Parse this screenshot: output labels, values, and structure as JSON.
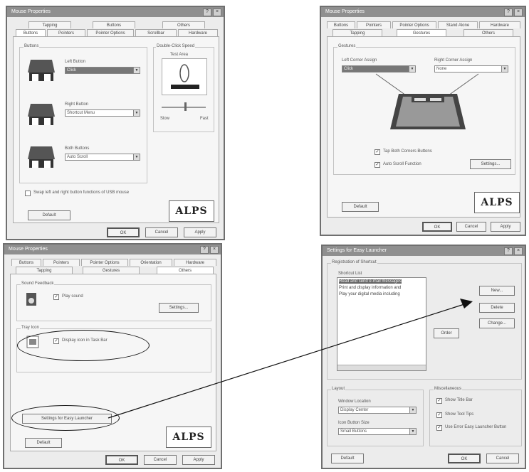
{
  "tl": {
    "title": "Mouse Properties",
    "tabs_row1": [
      "Tapping",
      "Buttons",
      "Others"
    ],
    "tabs_row2": [
      "Buttons",
      "Pointers",
      "Pointer Options",
      "Scrollbar",
      "Hardware"
    ],
    "buttons_group": "Buttons",
    "left_button_label": "Left Button",
    "left_button_value": "Click",
    "right_button_label": "Right Button",
    "right_button_value": "Shortcut Menu",
    "both_buttons_label": "Both Buttons",
    "both_buttons_value": "Auto Scroll",
    "dbl_click_group": "Double-Click Speed",
    "test_area": "Test Area",
    "slow": "Slow",
    "fast": "Fast",
    "swap_label": "Swap left and right button functions of USB mouse",
    "default_btn": "Default",
    "logo": "ALPS",
    "ok": "OK",
    "cancel": "Cancel",
    "apply": "Apply"
  },
  "tr": {
    "title": "Mouse Properties",
    "tabs_row1": [
      "Buttons",
      "Pointers",
      "Pointer Options",
      "Stand Alone",
      "Hardware"
    ],
    "tabs_row2": [
      "Tapping",
      "Gestures",
      "Others"
    ],
    "group": "Gestures",
    "left_corner_label": "Left Corner Assign",
    "left_corner_value": "Click",
    "right_corner_label": "Right Corner Assign",
    "right_corner_value": "None",
    "cb_tap_both": "Tap Both Corners Buttons",
    "cb_scroll": "Auto Scroll Function",
    "settings_btn": "Settings...",
    "default_btn": "Default",
    "logo": "ALPS",
    "ok": "OK",
    "cancel": "Cancel",
    "apply": "Apply"
  },
  "bl": {
    "title": "Mouse Properties",
    "tabs_row1": [
      "Buttons",
      "Pointers",
      "Pointer Options",
      "Orientation",
      "Hardware"
    ],
    "tabs_row2": [
      "Tapping",
      "Gestures",
      "Others"
    ],
    "sound_group": "Sound Feedback",
    "sound_cb": "Play sound",
    "settings_btn": "Settings...",
    "tray_group": "Tray Icon",
    "tray_cb": "Display icon in Task Bar",
    "easy_launcher_btn": "Settings for Easy Launcher",
    "default_btn": "Default",
    "logo": "ALPS",
    "ok": "OK",
    "cancel": "Cancel",
    "apply": "Apply"
  },
  "br": {
    "title": "Settings for Easy Launcher",
    "registration_group": "Registration of Shortcut",
    "shortcut_list_label": "Shortcut List",
    "list_items": [
      "Read and send e-mail messages",
      "Print and display information and",
      "Play your digital media including"
    ],
    "new_btn": "New...",
    "delete_btn": "Delete",
    "change_btn": "Change...",
    "order_btn": "Order",
    "layout_group": "Layout",
    "window_location_label": "Window Location",
    "window_location_value": "Display Center",
    "icon_button_size_label": "Icon Button Size",
    "icon_button_size_value": "Small Buttons",
    "misc_group": "Miscellaneous",
    "misc_show_title": "Show Title Bar",
    "misc_tool_tips": "Show Tool Tips",
    "misc_use_error": "Use Error Easy Launcher Button",
    "default_btn": "Default",
    "ok": "OK",
    "cancel": "Cancel"
  }
}
